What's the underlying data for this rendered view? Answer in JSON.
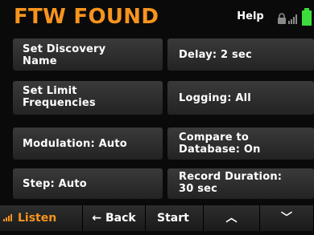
{
  "header": {
    "title": "FTW FOUND",
    "help_label": "Help",
    "status_icons": [
      "lock-icon",
      "signal-strength-icon",
      "battery-icon"
    ]
  },
  "buttons": {
    "set_discovery_name": "Set Discovery\nName",
    "delay": "Delay: 2 sec",
    "set_limit_frequencies": "Set Limit\nFrequencies",
    "logging": "Logging: All",
    "modulation": "Modulation: Auto",
    "compare_database": "Compare to\nDatabase: On",
    "step": "Step: Auto",
    "record_duration": "Record Duration:\n30 sec"
  },
  "footer": {
    "listen_label": "Listen",
    "back_arrow": "←",
    "back_label": "Back",
    "start_label": "Start",
    "up_chevron": "︿",
    "down_chevron": "﹀"
  },
  "colors": {
    "accent": "#f7941d",
    "background": "#0a0a0a",
    "button": "#2e2e2e",
    "text": "#ffffff",
    "battery": "#3ddc3d"
  }
}
